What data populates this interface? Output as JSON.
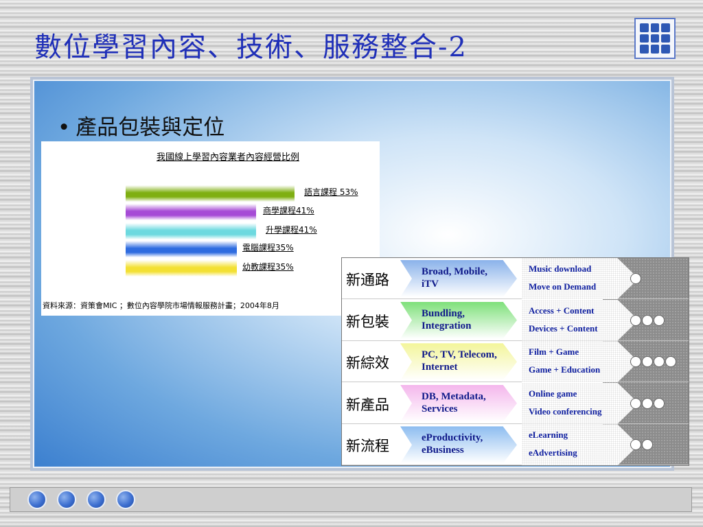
{
  "title": "數位學習內容、技術、服務整合-2",
  "bullet": "產品包裝與定位",
  "bullet_dot": "•",
  "chart_data": {
    "type": "bar",
    "title": "我國線上學習內容業者內容經營比例",
    "categories": [
      "語言課程",
      "商學課程",
      "升學課程",
      "電腦課程",
      "幼教課程"
    ],
    "values": [
      53,
      41,
      41,
      35,
      35
    ],
    "labels": [
      "語言課程 53%",
      "商學課程41%",
      "升學課程41%",
      "電腦課程35%",
      "幼教課程35%"
    ],
    "colors": [
      "#7faf12",
      "#a64bd6",
      "#6cd9df",
      "#2e6ce0",
      "#f3e033"
    ],
    "source": "資料來源：資策會MIC ；數位內容學院市場情報服務計畫；2004年8月"
  },
  "matrix": {
    "rows": [
      {
        "label": "新通路",
        "chevron": [
          "Broad, Mobile,",
          "iTV"
        ],
        "color": "#8ab2ea",
        "items": [
          "Music download",
          "Move on Demand"
        ],
        "circles": 1
      },
      {
        "label": "新包裝",
        "chevron": [
          "Bundling,",
          "Integration"
        ],
        "color": "#7ee07a",
        "items": [
          "Access + Content",
          "Devices + Content"
        ],
        "circles": 3
      },
      {
        "label": "新綜效",
        "chevron": [
          "PC, TV, Telecom,",
          "Internet"
        ],
        "color": "#f3f59a",
        "items": [
          "Film + Game",
          "Game + Education"
        ],
        "circles": 4
      },
      {
        "label": "新產品",
        "chevron": [
          "DB, Metadata,",
          "Services"
        ],
        "color": "#f4b6ec",
        "items": [
          "Online game",
          "Video conferencing"
        ],
        "circles": 3
      },
      {
        "label": "新流程",
        "chevron": [
          "eProductivity,",
          "eBusiness"
        ],
        "color": "#8cbcf0",
        "items": [
          "eLearning",
          "eAdvertising"
        ],
        "circles": 2
      }
    ]
  },
  "nav": {
    "buttons": 4
  }
}
